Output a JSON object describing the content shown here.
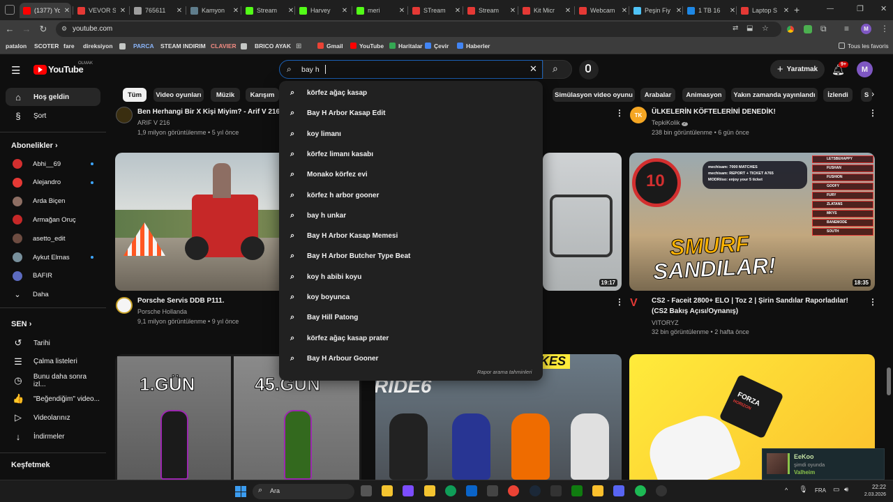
{
  "tabs": [
    {
      "title": "(1377) YouTube",
      "color": "#ff0000",
      "active": true
    },
    {
      "title": "VEVOR S",
      "color": "#e53935"
    },
    {
      "title": "765611",
      "color": "#9e9e9e"
    },
    {
      "title": "Kamyon",
      "color": "#5f7d8c"
    },
    {
      "title": "Stream",
      "color": "#53fc18"
    },
    {
      "title": "Harvey",
      "color": "#53fc18"
    },
    {
      "title": "meri",
      "color": "#53fc18"
    },
    {
      "title": "STream",
      "color": "#e53935"
    },
    {
      "title": "Stream",
      "color": "#e53935"
    },
    {
      "title": "Kit Micr",
      "color": "#e53935"
    },
    {
      "title": "Webcam",
      "color": "#e53935"
    },
    {
      "title": "Peşin Fiy",
      "color": "#4fc3f7"
    },
    {
      "title": "1 TB 16",
      "color": "#1e88e5"
    },
    {
      "title": "Laptop S",
      "color": "#e53935"
    }
  ],
  "window": {
    "new_tab": "+",
    "minimize": "—",
    "restore": "❐",
    "close": "✕"
  },
  "omnibox": {
    "url": "youtube.com"
  },
  "bookmarks": [
    {
      "label": "patalon"
    },
    {
      "label": "SCOTER"
    },
    {
      "label": "fare"
    },
    {
      "label": "direksiyon"
    },
    {
      "label": "PARCA",
      "color": "#8ab4f8"
    },
    {
      "label": "STEAM INDIRIM"
    },
    {
      "label": "CLAVIER",
      "color": "#f28b82"
    },
    {
      "label": "BRICO AYAK"
    },
    {
      "label": "Gmail"
    },
    {
      "label": "YouTube"
    },
    {
      "label": "Haritalar"
    },
    {
      "label": "Çevir"
    },
    {
      "label": "Haberler"
    }
  ],
  "bookmarks_all": "Tous les favoris",
  "yt": {
    "logo": "YouTube",
    "country": "OLMAK",
    "search_value": "bay h",
    "create": "Yaratmak",
    "notif_count": "9+",
    "avatar": "M",
    "report": "Rapor arama tahminleri"
  },
  "sidebar": {
    "main": [
      {
        "label": "Hoş geldin",
        "icon": "⌂"
      },
      {
        "label": "Şort",
        "icon": "§"
      }
    ],
    "subs_header": "Abonelikler",
    "subs": [
      {
        "label": "Abhi__69",
        "color": "#d32f2f",
        "dot": true
      },
      {
        "label": "Alejandro",
        "color": "#e53935",
        "dot": true
      },
      {
        "label": "Arda Biçen",
        "color": "#8d6e63"
      },
      {
        "label": "Armağan Oruç",
        "color": "#c62828"
      },
      {
        "label": "asetto_edit",
        "color": "#6d4c41"
      },
      {
        "label": "Aykut Elmas",
        "color": "#78909c",
        "dot": true
      },
      {
        "label": "BAFIR",
        "color": "#5c6bc0"
      },
      {
        "label": "Daha",
        "color": "transparent"
      }
    ],
    "you_header": "SEN",
    "you": [
      {
        "label": "Tarihi",
        "icon": "↺"
      },
      {
        "label": "Çalma listeleri",
        "icon": "☰"
      },
      {
        "label": "Bunu daha sonra izl...",
        "icon": "◷"
      },
      {
        "label": "\"Beğendiğim\" video...",
        "icon": "👍"
      },
      {
        "label": "Videolarınız",
        "icon": "▷"
      },
      {
        "label": "İndirmeler",
        "icon": "↓"
      }
    ],
    "explore_header": "Keşfetmek"
  },
  "chips": [
    "Tüm",
    "Video oyunları",
    "Müzik",
    "Karışım",
    "Simülasyon video oyunu",
    "Arabalar",
    "Animasyon",
    "Yakın zamanda yayınlandı",
    "İzlendi",
    "S"
  ],
  "suggestions": [
    "körfez ağaç kasap",
    "Bay H Arbor Kasap Edit",
    "koy limanı",
    "körfez limanı kasabı",
    "Monako körfez evi",
    "körfez h arbor gooner",
    "bay h unkar",
    "Bay H Arbor Kasap Memesi",
    "Bay H Arbor Butcher Type Beat",
    "koy h abibi koyu",
    "koy boyunca",
    "Bay Hill Patong",
    "körfez ağaç kasap prater",
    "Bay H Arbour Gooner"
  ],
  "videos": {
    "top_left": {
      "title": "Ben Herhangi Bir X Kişi Miyim? - Arif V 216",
      "channel": "ARIF V 216",
      "meta": "1,9 milyon görüntülenme • 5 yıl önce"
    },
    "top_right": {
      "title": "ÜLKELERİN KÖFTELERİNİ DENEDİK!",
      "channel": "TepkiKolik",
      "badge": "✓",
      "meta": "238 bin görüntülenme • 6 gün önce",
      "avatar": "TK"
    },
    "v1": {
      "title": "Porsche Servis DDB P111.",
      "channel": "Porsche Hollanda",
      "meta": "9,1 milyon görüntülenme • 9 yıl önce"
    },
    "v2": {
      "duration": "19:17"
    },
    "v3": {
      "title": "CS2 - Faceit 2800+ ELO | Toz 2 | Şirin Sandılar Raporladılar!",
      "title2": "(CS2 Bakış Açısı/Oynanış)",
      "channel": "VITORYZ",
      "meta": "32 bin görüntülenme • 2 hafta önce",
      "duration": "18:35",
      "overlay_num": "10",
      "overlay_big1": "SMURF",
      "overlay_big2": "SANDILAR!",
      "popup": [
        "mechisam: 7000 MATCHES",
        "mechisam: REPORT + TICKET A765",
        "MODRiiso: enjoy your 5 ticket"
      ],
      "kill_names": [
        "LETSBEHAPPY",
        "FUSHAN",
        "FUSHION",
        "GOOFY",
        "FURY",
        "ZLATANS",
        "MKYS",
        "BANEMODE",
        "SOUTH"
      ]
    },
    "v4": {
      "left": "1.GÜN",
      "right": "45.GÜN"
    },
    "v5": {
      "top": "SUPERBIKES",
      "big": "RIDE6"
    },
    "v6": {
      "brand": "FORZA",
      "sub": "HORIZON"
    }
  },
  "toast": {
    "name": "EeKoo",
    "status": "şimdi oyunda",
    "game": "Valheim"
  },
  "taskbar": {
    "search": "Ara",
    "lang": "FRA",
    "time": "22:22",
    "date": "2.03.2026"
  }
}
